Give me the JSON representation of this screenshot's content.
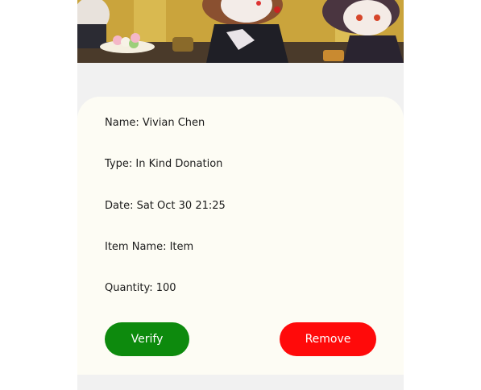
{
  "banner": {
    "image": "anime-chibi-characters-illustration"
  },
  "donation": {
    "name": "Name: Vivian Chen",
    "type": "Type: In Kind Donation",
    "date": "Date: Sat Oct 30 21:25",
    "item_name": "Item Name: Item",
    "quantity": "Quantity: 100"
  },
  "actions": {
    "verify_label": "Verify",
    "remove_label": "Remove"
  },
  "colors": {
    "verify": "#0d8a0d",
    "remove": "#ff0a0a",
    "card": "#fdfcf4",
    "background": "#f1f1f1"
  }
}
